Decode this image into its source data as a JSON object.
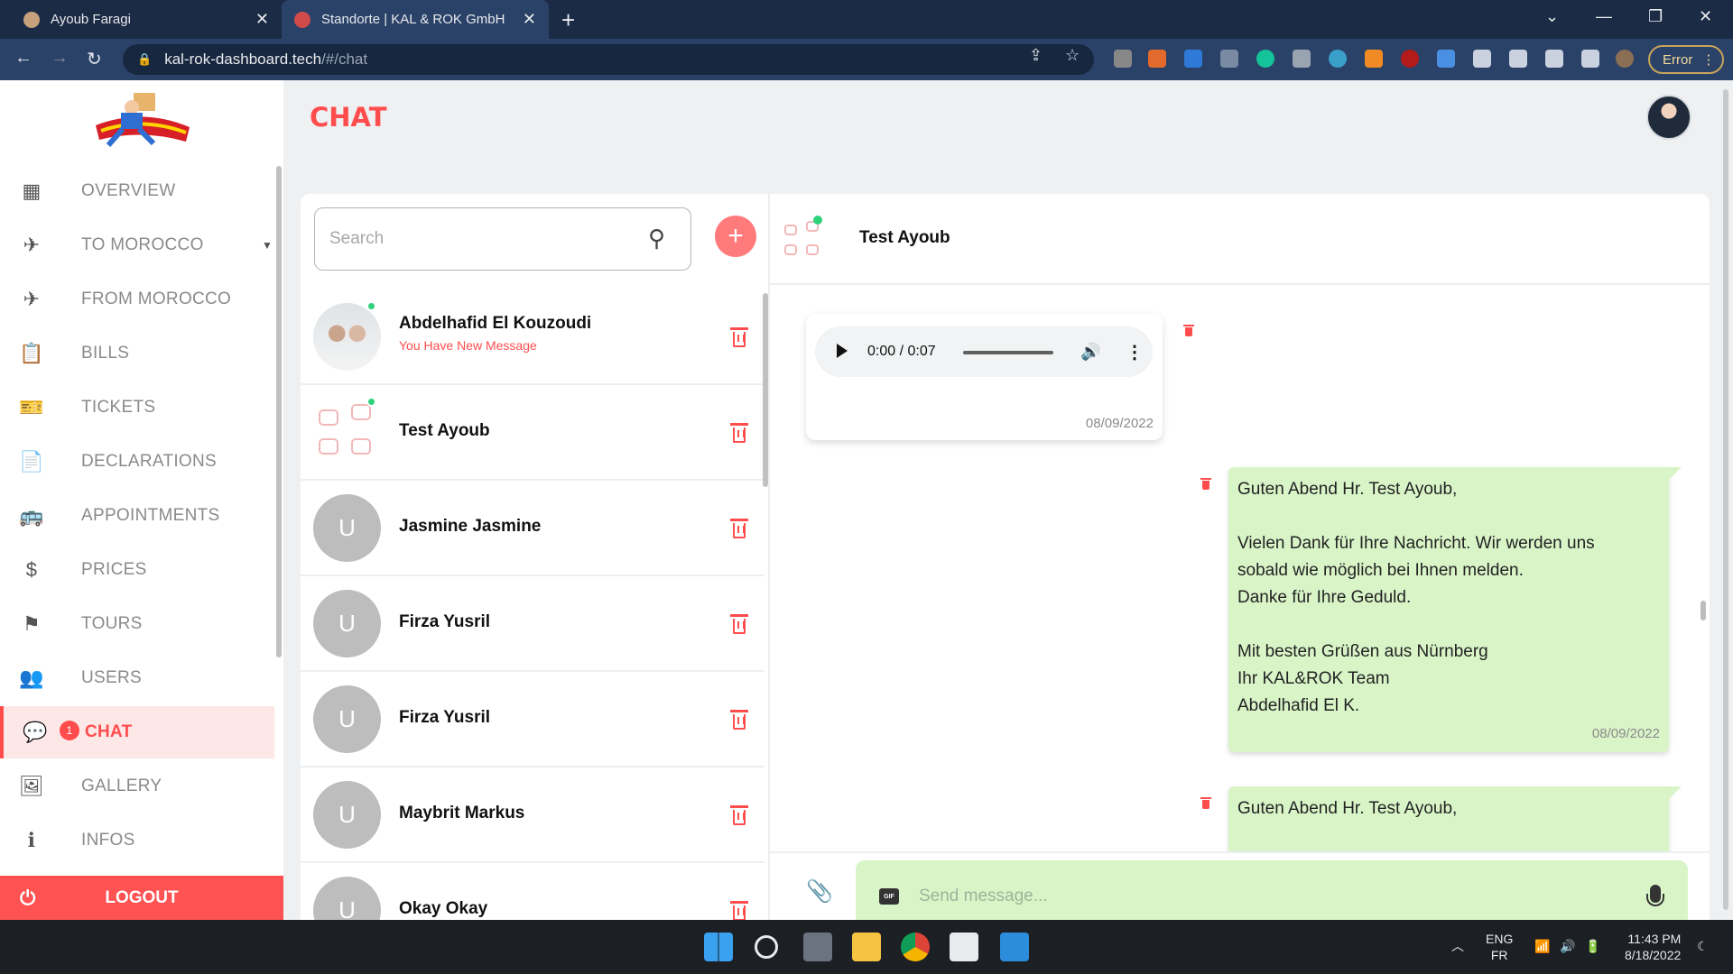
{
  "browser": {
    "tabs": [
      {
        "title": "Ayoub Faragi"
      },
      {
        "title": "Standorte | KAL & ROK GmbH"
      }
    ],
    "url_host": "kal-rok-dashboard.tech",
    "url_path": "/#/chat",
    "error_label": "Error"
  },
  "sidebar": {
    "items": [
      {
        "label": "OVERVIEW",
        "icon": "grid-icon"
      },
      {
        "label": "TO MOROCCO",
        "icon": "plane-departure-icon"
      },
      {
        "label": "FROM MOROCCO",
        "icon": "plane-arrival-icon"
      },
      {
        "label": "BILLS",
        "icon": "clipboard-check-icon"
      },
      {
        "label": "TICKETS",
        "icon": "ticket-icon"
      },
      {
        "label": "DECLARATIONS",
        "icon": "document-icon"
      },
      {
        "label": "APPOINTMENTS",
        "icon": "bus-clock-icon"
      },
      {
        "label": "PRICES",
        "icon": "dollar-icon"
      },
      {
        "label": "TOURS",
        "icon": "flag-icon"
      },
      {
        "label": "USERS",
        "icon": "users-icon"
      },
      {
        "label": "CHAT",
        "icon": "chat-icon",
        "badge": "1"
      },
      {
        "label": "GALLERY",
        "icon": "gallery-icon"
      },
      {
        "label": "INFOS",
        "icon": "info-icon"
      }
    ],
    "logout_label": "LOGOUT"
  },
  "page": {
    "title": "CHAT"
  },
  "chat": {
    "search_placeholder": "Search",
    "contacts": [
      {
        "name": "Abdelhafid El Kouzoudi",
        "subtitle": "You Have New Message",
        "avatar": "photo",
        "online": true
      },
      {
        "name": "Test Ayoub",
        "avatar": "sketch",
        "online": true
      },
      {
        "name": "Jasmine Jasmine",
        "initial": "U"
      },
      {
        "name": "Firza Yusril",
        "initial": "U"
      },
      {
        "name": "Firza Yusril",
        "initial": "U"
      },
      {
        "name": "Maybrit Markus",
        "initial": "U"
      },
      {
        "name": "Okay Okay",
        "initial": "U"
      }
    ],
    "active_contact": "Test Ayoub",
    "audio_message": {
      "time": "0:00 / 0:07",
      "date": "08/09/2022"
    },
    "text_message": {
      "lines": [
        "Guten Abend Hr. Test Ayoub,",
        "",
        "Vielen Dank für Ihre Nachricht. Wir werden uns",
        "sobald wie möglich bei Ihnen melden.",
        "Danke für Ihre Geduld.",
        "",
        "Mit besten Grüßen aus Nürnberg",
        "Ihr KAL&ROK Team",
        "Abdelhafid El K."
      ],
      "date": "08/09/2022"
    },
    "partial_message_first_line": "Guten Abend Hr. Test Ayoub,",
    "composer_placeholder": "Send message...",
    "gif_label": "GIF"
  },
  "taskbar": {
    "lang_top": "ENG",
    "lang_bottom": "FR",
    "time": "11:43 PM",
    "date": "8/18/2022"
  },
  "colors": {
    "accent": "#ff4d4d",
    "bubble_green": "#d9f5c8",
    "chrome_dark": "#1b2b45"
  }
}
